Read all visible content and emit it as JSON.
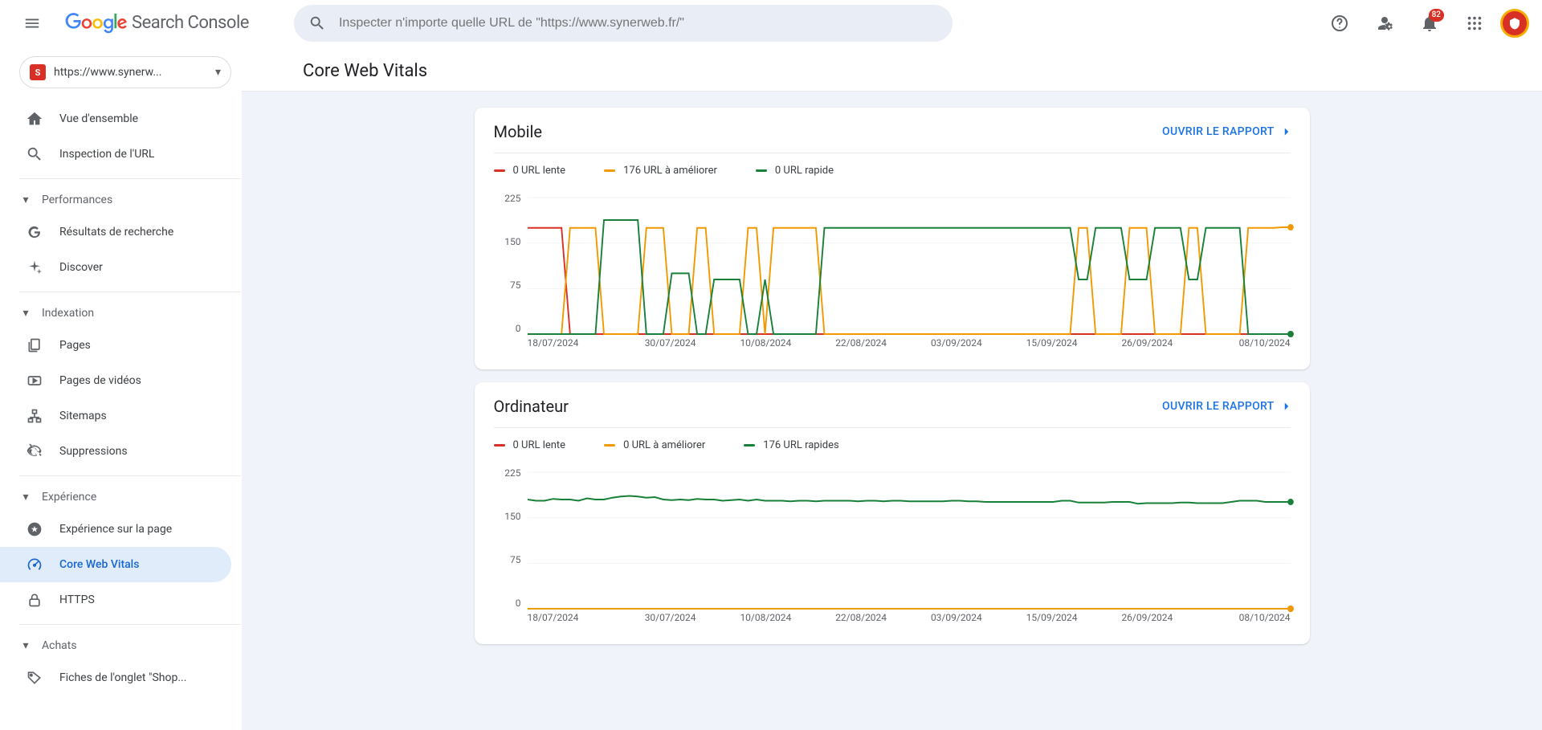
{
  "app_name": "Search Console",
  "header": {
    "search_placeholder": "Inspecter n'importe quelle URL de \"https://www.synerweb.fr/\"",
    "notifications_count": "82"
  },
  "property": {
    "label": "https://www.synerw..."
  },
  "sidebar": {
    "items": [
      {
        "label": "Vue d'ensemble",
        "icon": "home"
      },
      {
        "label": "Inspection de l'URL",
        "icon": "search"
      }
    ],
    "sections": [
      {
        "title": "Performances",
        "items": [
          {
            "label": "Résultats de recherche",
            "icon": "g"
          },
          {
            "label": "Discover",
            "icon": "asterisk"
          }
        ]
      },
      {
        "title": "Indexation",
        "items": [
          {
            "label": "Pages",
            "icon": "pages"
          },
          {
            "label": "Pages de vidéos",
            "icon": "video"
          },
          {
            "label": "Sitemaps",
            "icon": "sitemap"
          },
          {
            "label": "Suppressions",
            "icon": "hidden"
          }
        ]
      },
      {
        "title": "Expérience",
        "items": [
          {
            "label": "Expérience sur la page",
            "icon": "star-circle"
          },
          {
            "label": "Core Web Vitals",
            "icon": "speed",
            "active": true
          },
          {
            "label": "HTTPS",
            "icon": "lock"
          }
        ]
      },
      {
        "title": "Achats",
        "items": [
          {
            "label": "Fiches de l'onglet \"Shop...",
            "icon": "tag"
          }
        ]
      }
    ]
  },
  "page_title": "Core Web Vitals",
  "open_report_label": "OUVRIR LE RAPPORT",
  "cards": {
    "mobile": {
      "title": "Mobile",
      "legend": [
        "0 URL lente",
        "176 URL à améliorer",
        "0 URL rapide"
      ]
    },
    "desktop": {
      "title": "Ordinateur",
      "legend": [
        "0 URL lente",
        "0 URL à améliorer",
        "176 URL rapides"
      ]
    }
  },
  "chart_data": [
    {
      "id": "mobile",
      "type": "line",
      "ylim": [
        0,
        225
      ],
      "yticks": [
        225,
        150,
        75,
        0
      ],
      "xlabels": [
        "18/07/2024",
        "30/07/2024",
        "10/08/2024",
        "22/08/2024",
        "03/09/2024",
        "15/09/2024",
        "26/09/2024",
        "08/10/2024"
      ],
      "series": [
        {
          "name": "URL lente",
          "color": "#d93025",
          "values": [
            175,
            175,
            175,
            175,
            175,
            0,
            0,
            0,
            0,
            0,
            0,
            0,
            0,
            0,
            0,
            0,
            0,
            0,
            0,
            0,
            0,
            0,
            0,
            0,
            0,
            0,
            0,
            0,
            0,
            0,
            0,
            0,
            0,
            0,
            0,
            0,
            0,
            0,
            0,
            0,
            0,
            0,
            0,
            0,
            0,
            0,
            0,
            0,
            0,
            0,
            0,
            0,
            0,
            0,
            0,
            0,
            0,
            0,
            0,
            0,
            0,
            0,
            0,
            0,
            0,
            0,
            0,
            0,
            0,
            0,
            0,
            0,
            0,
            0,
            0,
            0,
            0,
            0,
            0,
            0,
            0,
            0,
            0,
            0,
            0,
            0,
            0,
            0,
            0,
            0,
            0
          ]
        },
        {
          "name": "URL à améliorer",
          "color": "#f29900",
          "values": [
            0,
            0,
            0,
            0,
            0,
            175,
            175,
            175,
            175,
            0,
            0,
            0,
            0,
            0,
            175,
            175,
            175,
            0,
            0,
            0,
            175,
            175,
            0,
            0,
            0,
            0,
            175,
            175,
            0,
            175,
            175,
            175,
            175,
            175,
            175,
            0,
            0,
            0,
            0,
            0,
            0,
            0,
            0,
            0,
            0,
            0,
            0,
            0,
            0,
            0,
            0,
            0,
            0,
            0,
            0,
            0,
            0,
            0,
            0,
            0,
            0,
            0,
            0,
            0,
            0,
            175,
            175,
            0,
            0,
            0,
            0,
            175,
            175,
            175,
            0,
            0,
            0,
            0,
            175,
            175,
            0,
            0,
            0,
            0,
            0,
            175,
            175,
            175,
            175,
            176,
            176
          ]
        },
        {
          "name": "URL rapide",
          "color": "#188038",
          "values": [
            0,
            0,
            0,
            0,
            0,
            0,
            0,
            0,
            0,
            188,
            188,
            188,
            188,
            188,
            0,
            0,
            0,
            100,
            100,
            100,
            0,
            0,
            90,
            90,
            90,
            90,
            0,
            0,
            90,
            0,
            0,
            0,
            0,
            0,
            0,
            175,
            175,
            175,
            175,
            175,
            175,
            175,
            175,
            175,
            175,
            175,
            175,
            175,
            175,
            175,
            175,
            175,
            175,
            175,
            175,
            175,
            175,
            175,
            175,
            175,
            175,
            175,
            175,
            175,
            175,
            90,
            90,
            175,
            175,
            175,
            175,
            90,
            90,
            90,
            175,
            175,
            175,
            175,
            90,
            90,
            175,
            175,
            175,
            175,
            175,
            0,
            0,
            0,
            0,
            0,
            0
          ]
        }
      ]
    },
    {
      "id": "desktop",
      "type": "line",
      "ylim": [
        0,
        225
      ],
      "yticks": [
        225,
        150,
        75,
        0
      ],
      "xlabels": [
        "18/07/2024",
        "30/07/2024",
        "10/08/2024",
        "22/08/2024",
        "03/09/2024",
        "15/09/2024",
        "26/09/2024",
        "08/10/2024"
      ],
      "series": [
        {
          "name": "URL lente",
          "color": "#d93025",
          "values": [
            0,
            0,
            0,
            0,
            0,
            0,
            0,
            0,
            0,
            0,
            0,
            0,
            0,
            0,
            0,
            0,
            0,
            0,
            0,
            0,
            0,
            0,
            0,
            0,
            0,
            0,
            0,
            0,
            0,
            0,
            0,
            0,
            0,
            0,
            0,
            0,
            0,
            0,
            0,
            0,
            0,
            0,
            0,
            0,
            0,
            0,
            0,
            0,
            0,
            0,
            0,
            0,
            0,
            0,
            0,
            0,
            0,
            0,
            0,
            0,
            0,
            0,
            0,
            0,
            0,
            0,
            0,
            0,
            0,
            0,
            0,
            0,
            0,
            0,
            0,
            0,
            0,
            0,
            0,
            0,
            0,
            0,
            0,
            0,
            0,
            0,
            0,
            0,
            0,
            0,
            0
          ]
        },
        {
          "name": "URL à améliorer",
          "color": "#f29900",
          "values": [
            0,
            0,
            0,
            0,
            0,
            0,
            0,
            0,
            0,
            0,
            0,
            0,
            0,
            0,
            0,
            0,
            0,
            0,
            0,
            0,
            0,
            0,
            0,
            0,
            0,
            0,
            0,
            0,
            0,
            0,
            0,
            0,
            0,
            0,
            0,
            0,
            0,
            0,
            0,
            0,
            0,
            0,
            0,
            0,
            0,
            0,
            0,
            0,
            0,
            0,
            0,
            0,
            0,
            0,
            0,
            0,
            0,
            0,
            0,
            0,
            0,
            0,
            0,
            0,
            0,
            0,
            0,
            0,
            0,
            0,
            0,
            0,
            0,
            0,
            0,
            0,
            0,
            0,
            0,
            0,
            0,
            0,
            0,
            0,
            0,
            0,
            0,
            0,
            0,
            0,
            0
          ]
        },
        {
          "name": "URL rapide",
          "color": "#188038",
          "values": [
            180,
            178,
            178,
            181,
            180,
            180,
            178,
            182,
            180,
            180,
            183,
            185,
            186,
            185,
            183,
            184,
            180,
            179,
            180,
            179,
            181,
            180,
            180,
            178,
            179,
            180,
            178,
            180,
            178,
            178,
            178,
            177,
            178,
            178,
            177,
            178,
            178,
            178,
            178,
            177,
            178,
            178,
            177,
            178,
            178,
            177,
            177,
            177,
            177,
            177,
            178,
            178,
            177,
            177,
            176,
            176,
            176,
            176,
            176,
            176,
            176,
            176,
            176,
            178,
            178,
            175,
            175,
            175,
            175,
            176,
            176,
            176,
            173,
            174,
            174,
            174,
            174,
            175,
            175,
            174,
            174,
            174,
            174,
            176,
            178,
            178,
            178,
            176,
            176,
            176,
            176
          ]
        }
      ]
    }
  ]
}
